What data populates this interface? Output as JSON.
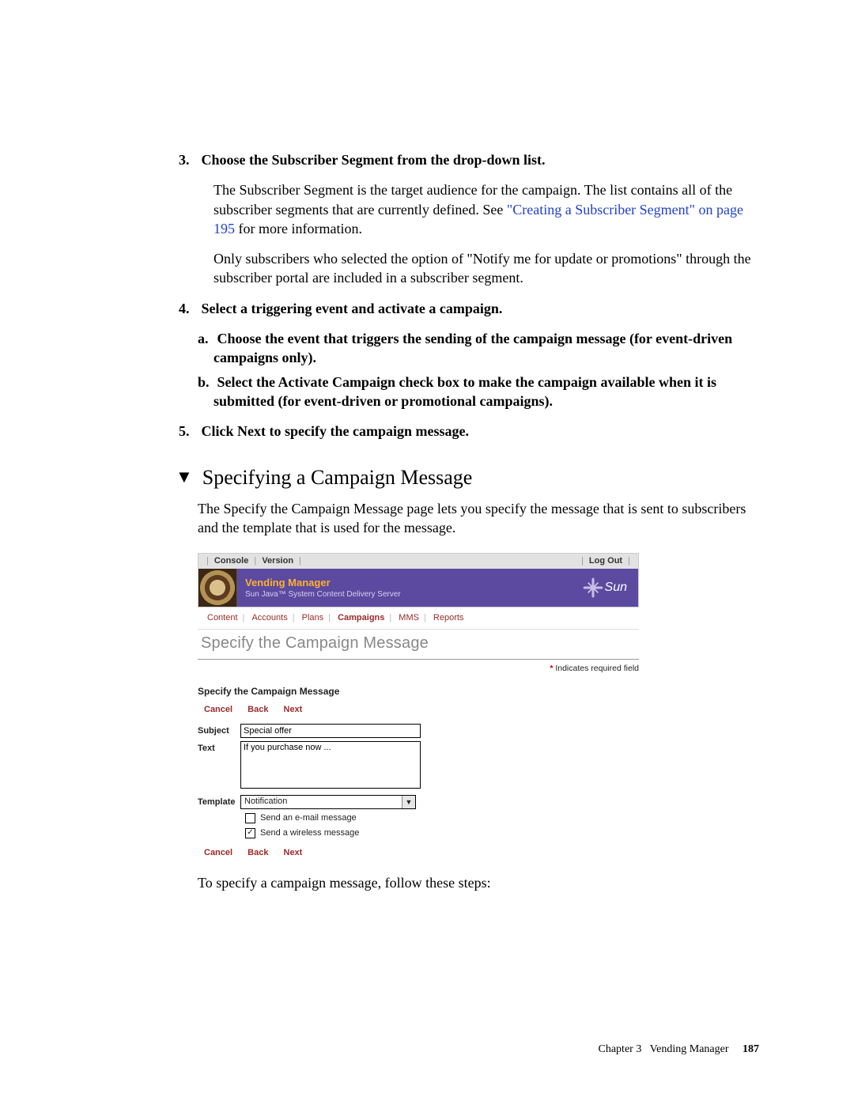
{
  "steps": {
    "s3": {
      "num": "3.",
      "title": "Choose the Subscriber Segment from the drop-down list.",
      "body1a": "The Subscriber Segment is the target audience for the campaign. The list contains all of the subscriber segments that are currently defined. See ",
      "link": "\"Creating a Subscriber Segment\" on page 195",
      "body1b": " for more information.",
      "body2": "Only subscribers who selected the option of \"Notify me for update or promotions\" through the subscriber portal are included in a subscriber segment."
    },
    "s4": {
      "num": "4.",
      "title": "Select a triggering event and activate a campaign.",
      "a_letter": "a.",
      "a_text": "Choose the event that triggers the sending of the campaign message (for event-driven campaigns only).",
      "b_letter": "b.",
      "b_text": "Select the Activate Campaign check box to make the campaign available when it is submitted (for event-driven or promotional campaigns)."
    },
    "s5": {
      "num": "5.",
      "title": "Click Next to specify the campaign message."
    }
  },
  "heading": "Specifying a Campaign Message",
  "heading_intro": "The Specify the Campaign Message page lets you specify the message that is sent to subscribers and the template that is used for the message.",
  "screenshot": {
    "top": {
      "console": "Console",
      "version": "Version",
      "logout": "Log Out"
    },
    "banner": {
      "title": "Vending Manager",
      "subtitle": "Sun Java™ System Content Delivery Server",
      "sun": "Sun"
    },
    "tabs": {
      "content": "Content",
      "accounts": "Accounts",
      "plans": "Plans",
      "campaigns": "Campaigns",
      "mms": "MMS",
      "reports": "Reports"
    },
    "page_title": "Specify the Campaign Message",
    "required_ast": "*",
    "required_label": " Indicates required field",
    "form_title": "Specify the Campaign Message",
    "buttons": {
      "cancel": "Cancel",
      "back": "Back",
      "next": "Next"
    },
    "labels": {
      "subject": "Subject",
      "text": "Text",
      "template": "Template"
    },
    "values": {
      "subject": "Special offer",
      "text": "If you purchase now ...",
      "template": "Notification"
    },
    "checks": {
      "email": "Send an e-mail message",
      "wireless": "Send a wireless message"
    }
  },
  "outro": "To specify a campaign message, follow these steps:",
  "footer": {
    "chapter": "Chapter 3",
    "title": "Vending Manager",
    "page": "187"
  }
}
